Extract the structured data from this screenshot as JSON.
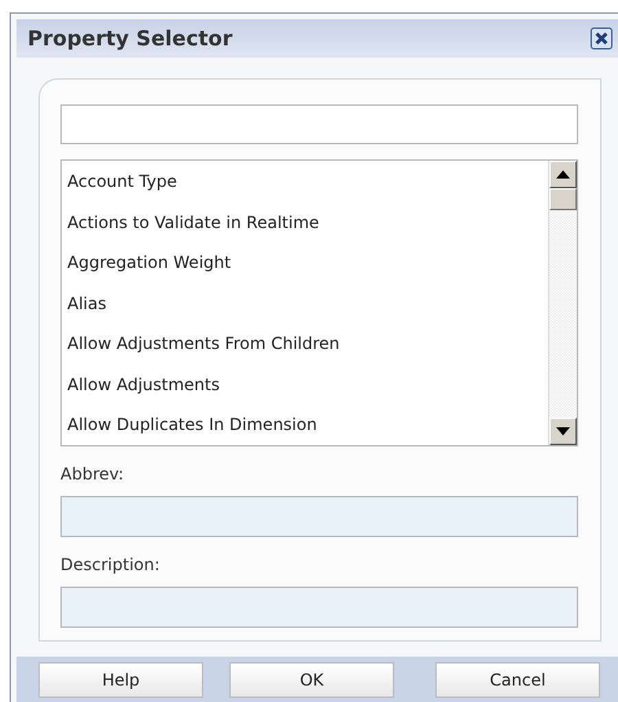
{
  "window": {
    "title": "Property Selector"
  },
  "list": {
    "items": [
      {
        "label": "Account Type",
        "selected": false
      },
      {
        "label": "Actions to Validate in Realtime",
        "selected": false
      },
      {
        "label": "Aggregation Weight",
        "selected": false
      },
      {
        "label": "Alias",
        "selected": false
      },
      {
        "label": "Allow Adjustments From Children",
        "selected": false
      },
      {
        "label": "Allow Adjustments",
        "selected": false
      },
      {
        "label": "Allow Duplicates In Dimension",
        "selected": false
      }
    ]
  },
  "fields": [
    {
      "label": "Abbrev:"
    },
    {
      "label": "Description:"
    }
  ],
  "buttons": [
    {
      "label": "Help"
    },
    {
      "label": "OK"
    },
    {
      "label": "Cancel"
    }
  ]
}
